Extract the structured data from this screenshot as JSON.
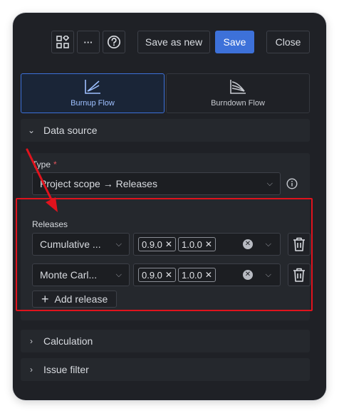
{
  "toolbar": {
    "grid_icon": "apps-grid-icon",
    "more_label": "···",
    "help_icon": "help-circle-icon",
    "save_as_new_label": "Save as new",
    "save_label": "Save",
    "close_label": "Close"
  },
  "chart_types": [
    {
      "label": "Burnup Flow",
      "icon": "burnup-chart-icon",
      "active": true
    },
    {
      "label": "Burndown Flow",
      "icon": "burndown-chart-icon",
      "active": false
    }
  ],
  "data_source": {
    "header": "Data source",
    "type_label": "Type",
    "required_mark": "*",
    "type_value": "Project scope → Releases",
    "info_icon": "info-icon"
  },
  "releases": {
    "label": "Releases",
    "rows": [
      {
        "mode": "Cumulative ...",
        "versions": [
          "0.9.0",
          "1.0.0"
        ]
      },
      {
        "mode": "Monte Carl...",
        "versions": [
          "0.9.0",
          "1.0.0"
        ]
      }
    ],
    "add_label": "Add release",
    "add_symbol": "+",
    "chip_remove": "✕",
    "clear_symbol": "✕",
    "delete_icon": "trash-icon"
  },
  "calculation": {
    "header": "Calculation"
  },
  "issue_filter": {
    "header": "Issue filter"
  },
  "annotation": {
    "highlight_color": "#e0131d",
    "arrow_color": "#e0131d"
  },
  "colors": {
    "accent": "#3d71d9",
    "panel_bg": "#1f2126"
  }
}
